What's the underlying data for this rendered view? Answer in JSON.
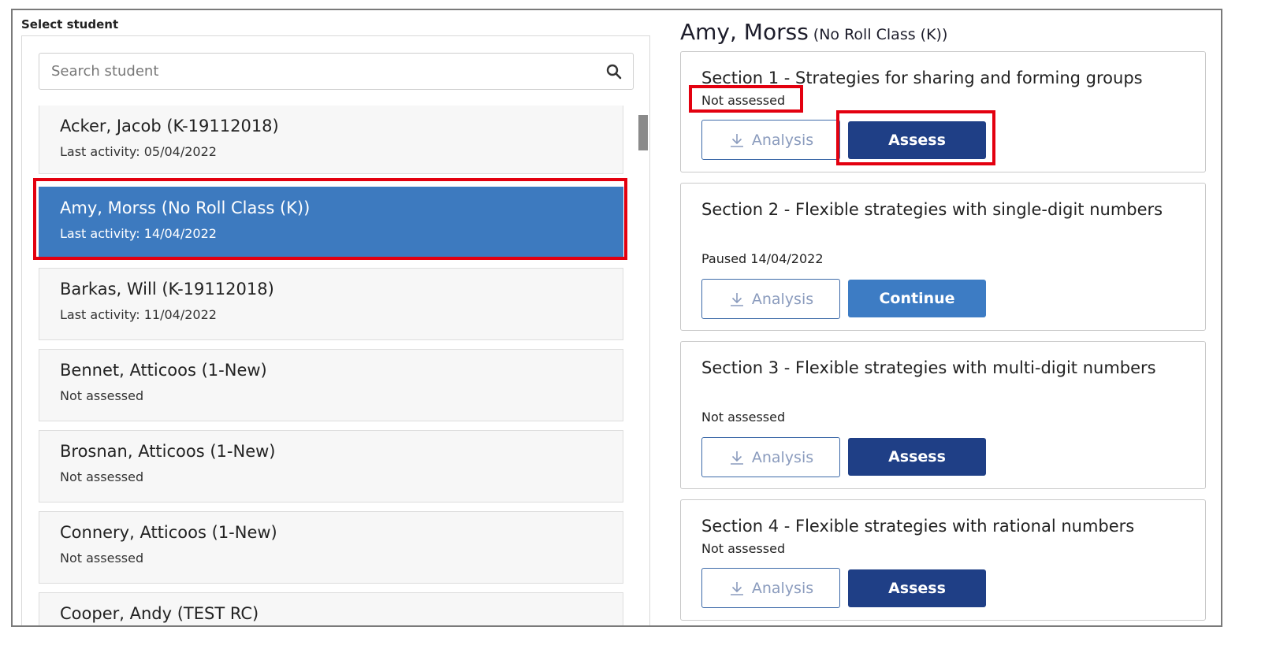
{
  "left": {
    "select_label": "Select student",
    "search_placeholder": "Search student",
    "students": [
      {
        "name": "Acker, Jacob (K-19112018)",
        "sub": "Last activity: 05/04/2022"
      },
      {
        "name": "Amy, Morss (No Roll Class (K))",
        "sub": "Last activity: 14/04/2022",
        "selected": true
      },
      {
        "name": "Barkas, Will (K-19112018)",
        "sub": "Last activity: 11/04/2022"
      },
      {
        "name": "Bennet, Atticoos (1-New)",
        "sub": "Not assessed"
      },
      {
        "name": "Brosnan, Atticoos (1-New)",
        "sub": "Not assessed"
      },
      {
        "name": "Connery, Atticoos (1-New)",
        "sub": "Not assessed"
      },
      {
        "name": "Cooper, Andy (TEST RC)",
        "sub": ""
      }
    ]
  },
  "right": {
    "student_name": "Amy, Morss",
    "student_class": "(No Roll Class (K))",
    "sections": [
      {
        "title": "Section 1 - Strategies for sharing and forming groups",
        "status": "Not assessed",
        "analysis_label": "Analysis",
        "action_label": "Assess"
      },
      {
        "title": "Section 2 - Flexible strategies with single-digit numbers",
        "status": "Paused 14/04/2022",
        "analysis_label": "Analysis",
        "action_label": "Continue"
      },
      {
        "title": "Section 3 - Flexible strategies with multi-digit numbers",
        "status": "Not assessed",
        "analysis_label": "Analysis",
        "action_label": "Assess"
      },
      {
        "title": "Section 4 - Flexible strategies with rational numbers",
        "status": "Not assessed",
        "analysis_label": "Analysis",
        "action_label": "Assess"
      }
    ]
  },
  "colors": {
    "selected_row": "#3d7abf",
    "assess_button": "#1f3f86",
    "continue_button": "#3d7cc4",
    "highlight_box": "#e3000f"
  },
  "icons": {
    "search": "search-icon",
    "download": "download-icon"
  }
}
